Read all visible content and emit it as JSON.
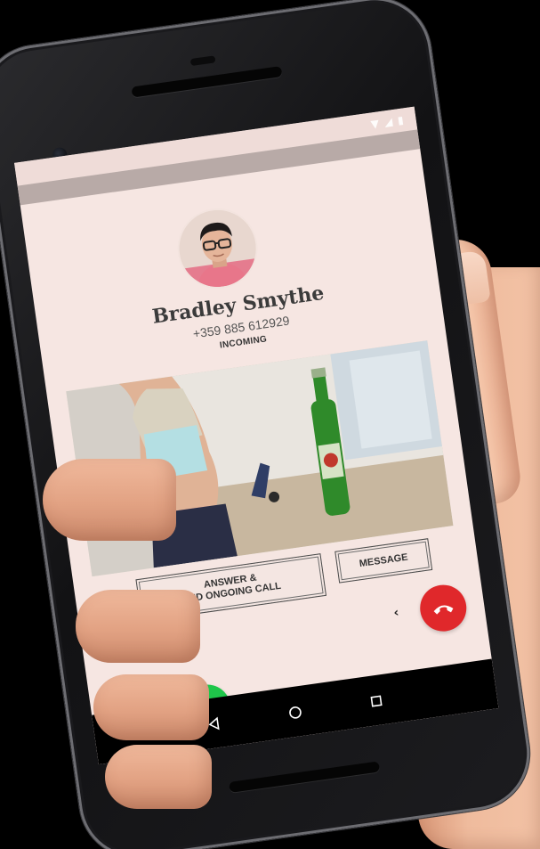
{
  "caller": {
    "name": "Bradley Smythe",
    "number": "+359 885 612929",
    "state": "INCOMING"
  },
  "actions": {
    "answer_end_line1": "ANSWER &",
    "answer_end_line2": "END ONGOING CALL",
    "message": "MESSAGE"
  },
  "icons": {
    "decline": "phone-hangup-icon",
    "accept": "phone-answer-icon",
    "slide_left": "chevron-left-icon",
    "slide_right": "chevron-right-icon",
    "nav_back": "triangle-back-icon",
    "nav_home": "circle-home-icon",
    "nav_recents": "square-recents-icon"
  },
  "chevrons": {
    "left": "‹",
    "right": "›"
  },
  "colors": {
    "screen_bg": "#f6e6e2",
    "decline": "#e0282b",
    "accept": "#1fc64a",
    "text": "#3b3b3b"
  }
}
